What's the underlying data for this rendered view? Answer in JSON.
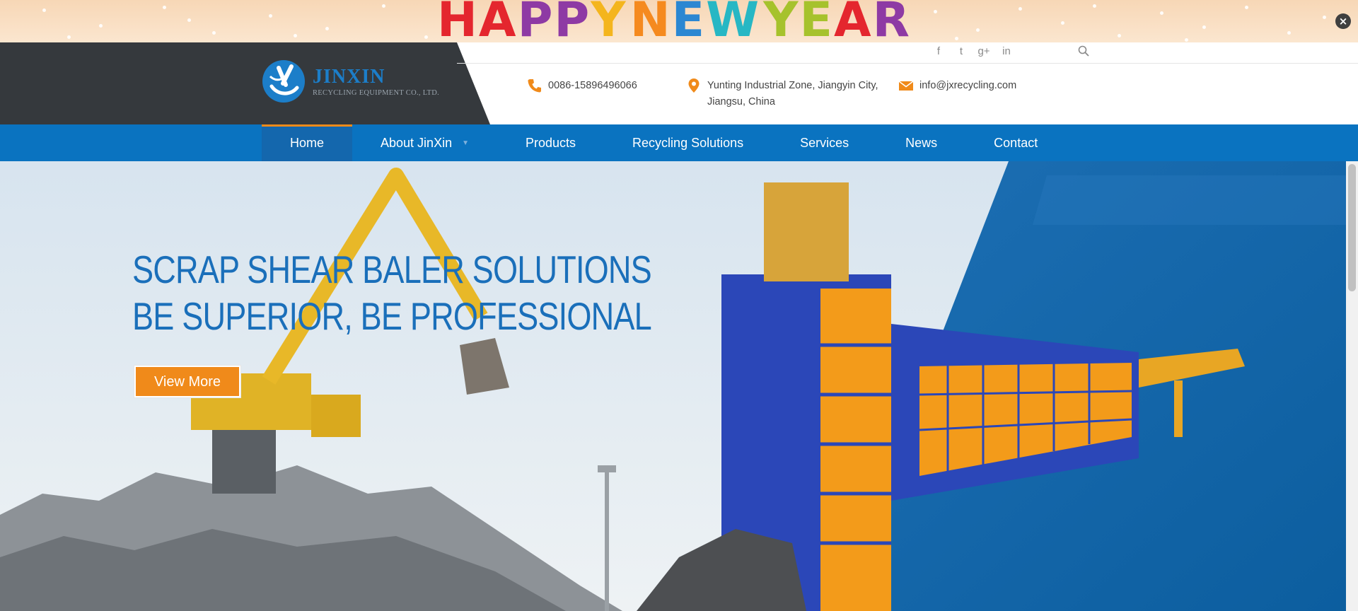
{
  "banner": {
    "letters": [
      {
        "char": "H",
        "color": "#e4262e"
      },
      {
        "char": "A",
        "color": "#e4262e"
      },
      {
        "char": "P",
        "color": "#8e3aa4"
      },
      {
        "char": "P",
        "color": "#8e3aa4"
      },
      {
        "char": "Y",
        "color": "#f4b51d"
      },
      {
        "char": " ",
        "color": "#000000"
      },
      {
        "char": "N",
        "color": "#f58a1f"
      },
      {
        "char": "E",
        "color": "#2b87d2"
      },
      {
        "char": "W",
        "color": "#27b7c4"
      },
      {
        "char": " ",
        "color": "#000000"
      },
      {
        "char": "Y",
        "color": "#a6c22c"
      },
      {
        "char": "E",
        "color": "#a6c22c"
      },
      {
        "char": "A",
        "color": "#e4262e"
      },
      {
        "char": "R",
        "color": "#8e3aa4"
      }
    ],
    "close_label": "×"
  },
  "logo": {
    "name": "JINXIN",
    "subtitle": "RECYCLING EQUIPMENT CO., LTD."
  },
  "social": {
    "facebook": "f",
    "twitter": "t",
    "googleplus": "g+",
    "linkedin": "in"
  },
  "contact": {
    "phone": "0086-15896496066",
    "address_line1": "Yunting Industrial Zone, Jiangyin City,",
    "address_line2": "Jiangsu, China",
    "email": "info@jxrecycling.com"
  },
  "nav": {
    "items": [
      {
        "label": "Home",
        "active": true
      },
      {
        "label": "About JinXin",
        "active": false
      },
      {
        "label": "Products",
        "active": false
      },
      {
        "label": "Recycling Solutions",
        "active": false
      },
      {
        "label": "Services",
        "active": false
      },
      {
        "label": "News",
        "active": false
      },
      {
        "label": "Contact",
        "active": false
      }
    ]
  },
  "hero": {
    "headline_line1": "SCRAP SHEAR BALER SOLUTIONS",
    "headline_line2": "BE SUPERIOR, BE PROFESSIONAL",
    "button_label": "View More"
  },
  "colors": {
    "brand_blue": "#0a73c0",
    "accent_orange": "#f08a1a",
    "header_dark": "#35393d"
  },
  "icons": [
    "close-icon",
    "facebook-icon",
    "twitter-icon",
    "google-plus-icon",
    "linkedin-icon",
    "search-icon",
    "phone-icon",
    "location-pin-icon",
    "mail-icon",
    "dropdown-caret-icon"
  ]
}
